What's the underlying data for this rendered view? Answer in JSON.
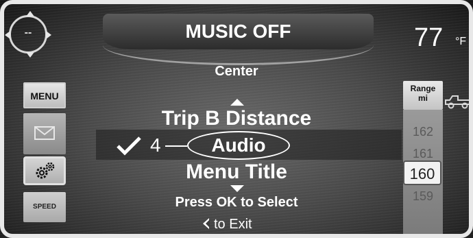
{
  "header": {
    "title": "MUSIC OFF"
  },
  "compass": {
    "label": "--"
  },
  "temperature": {
    "value": "77",
    "unit": "°F"
  },
  "left_column": {
    "menu_label": "MENU",
    "speed_label": "SPEED"
  },
  "right_column": {
    "range_label_line1": "Range",
    "range_label_line2": "mi",
    "range_values": [
      "162",
      "161",
      "160",
      "159"
    ],
    "current_range": "160"
  },
  "menu": {
    "section_label": "Center",
    "previous_item": "Trip B Distance",
    "selected_number": "4",
    "selected_item": "Audio",
    "next_item": "Menu Title",
    "instruction": "Press OK to Select",
    "exit_label": "to Exit"
  },
  "icons": [
    "compass-icon",
    "mail-icon",
    "gear-icon",
    "truck-icon",
    "checkmark-icon",
    "back-arrow-icon",
    "up-arrow-icon",
    "down-arrow-icon"
  ]
}
